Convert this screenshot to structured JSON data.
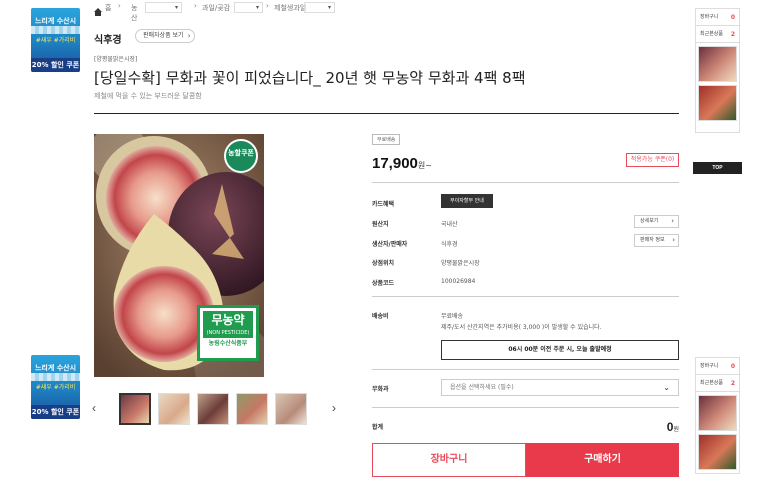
{
  "left_banner": {
    "line1": "느리게 수산시",
    "line2": "#새우 #가리비",
    "coupon": "20% 할인 쿠폰"
  },
  "breadcrumb": {
    "home": "홈",
    "level1": "농산",
    "level2": "과일/곶감",
    "level3": "제철생과일"
  },
  "seller": {
    "name": "식후경",
    "other_products_label": "판매자상품 보기"
  },
  "product": {
    "store_tag": "[양평물맑은시장]",
    "title": "[당일수확] 무화과 꽃이 피었습니다_ 20년 햇 무농약 무화과 4팩 8팩",
    "subtitle": "제철에 먹을 수 있는 부드러운 달콤함",
    "badge_coupon": "농할쿠폰",
    "badge_pesticide_main": "무농약",
    "badge_pesticide_en": "(NON PESTICIDE)",
    "badge_pesticide_org": "농림수산식품부"
  },
  "purchase": {
    "free_shipping_tag": "무료배송",
    "price": "17,900",
    "price_unit": "원~",
    "coupon_button": "적용가능 쿠폰(0)",
    "rows": {
      "card_benefit_label": "카드혜택",
      "card_benefit_button": "무이자할부 안내",
      "origin_label": "원산지",
      "origin_value": "국내산",
      "origin_button": "상세보기",
      "seller_label": "생산자/판매자",
      "seller_value": "식후경",
      "seller_button": "판매자 정보",
      "store_label": "상점위치",
      "store_value": "양평물맑은시장",
      "code_label": "상품코드",
      "code_value": "100026984",
      "shipping_label": "배송비",
      "shipping_value": "무료배송",
      "shipping_note": "제주/도서 산간지역은 추가비용( 3,000 )이 발생할 수 있습니다.",
      "shipping_notice": "06시 00분 이전 주문 시, 오늘 출발예정",
      "option_label": "무화과",
      "option_placeholder": "옵션을 선택하세요 (필수)",
      "total_label": "합계",
      "total_value": "0",
      "total_unit": "원"
    },
    "cart_button": "장바구니",
    "buy_button": "구매하기"
  },
  "side_panel": {
    "cart_label": "장바구니",
    "cart_count": "0",
    "recent_label": "최근본상품",
    "recent_count": "2",
    "top_label": "TOP"
  },
  "colors": {
    "accent": "#e83a4a",
    "text": "#222222"
  },
  "icons": {
    "home": "home-icon",
    "prev": "chevron-left-icon",
    "next": "chevron-right-icon",
    "dropdown": "chevron-down-icon"
  }
}
